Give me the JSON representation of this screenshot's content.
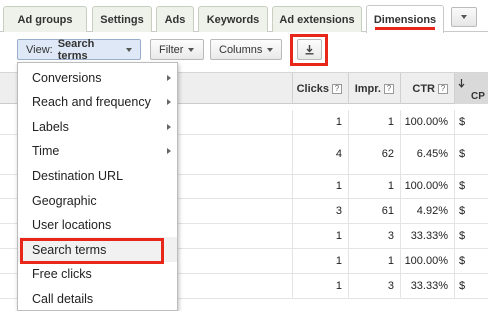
{
  "tabs": [
    {
      "label": "Ad groups"
    },
    {
      "label": "Settings"
    },
    {
      "label": "Ads"
    },
    {
      "label": "Keywords"
    },
    {
      "label": "Ad extensions"
    },
    {
      "label": "Dimensions",
      "active": true
    }
  ],
  "toolbar": {
    "view_label": "View:",
    "view_value": "Search terms",
    "filter_label": "Filter",
    "columns_label": "Columns"
  },
  "table": {
    "headers": {
      "clicks": "Clicks",
      "impr": "Impr.",
      "ctr": "CTR",
      "cpc": "CP",
      "help": "?"
    },
    "rows": [
      {
        "clicks": "1",
        "impr": "1",
        "ctr": "100.00%",
        "cpc": "$"
      },
      {
        "clicks": "4",
        "impr": "62",
        "ctr": "6.45%",
        "cpc": "$"
      },
      {
        "clicks": "1",
        "impr": "1",
        "ctr": "100.00%",
        "cpc": "$"
      },
      {
        "clicks": "3",
        "impr": "61",
        "ctr": "4.92%",
        "cpc": "$"
      },
      {
        "clicks": "1",
        "impr": "3",
        "ctr": "33.33%",
        "cpc": "$"
      },
      {
        "clicks": "1",
        "impr": "1",
        "ctr": "100.00%",
        "cpc": "$"
      },
      {
        "clicks": "1",
        "impr": "3",
        "ctr": "33.33%",
        "cpc": "$"
      }
    ]
  },
  "menu": {
    "items": [
      {
        "label": "Conversions",
        "submenu": true
      },
      {
        "label": "Reach and frequency",
        "submenu": true
      },
      {
        "label": "Labels",
        "submenu": true
      },
      {
        "label": "Time",
        "submenu": true
      },
      {
        "label": "Destination URL"
      },
      {
        "label": "Geographic"
      },
      {
        "label": "User locations"
      },
      {
        "label": "Search terms",
        "selected": true
      },
      {
        "label": "Free clicks"
      },
      {
        "label": "Call details"
      }
    ]
  },
  "colors": {
    "highlight": "#e8261a",
    "tab_bg": "#eef2ea",
    "header_bg": "#eeeeee"
  }
}
